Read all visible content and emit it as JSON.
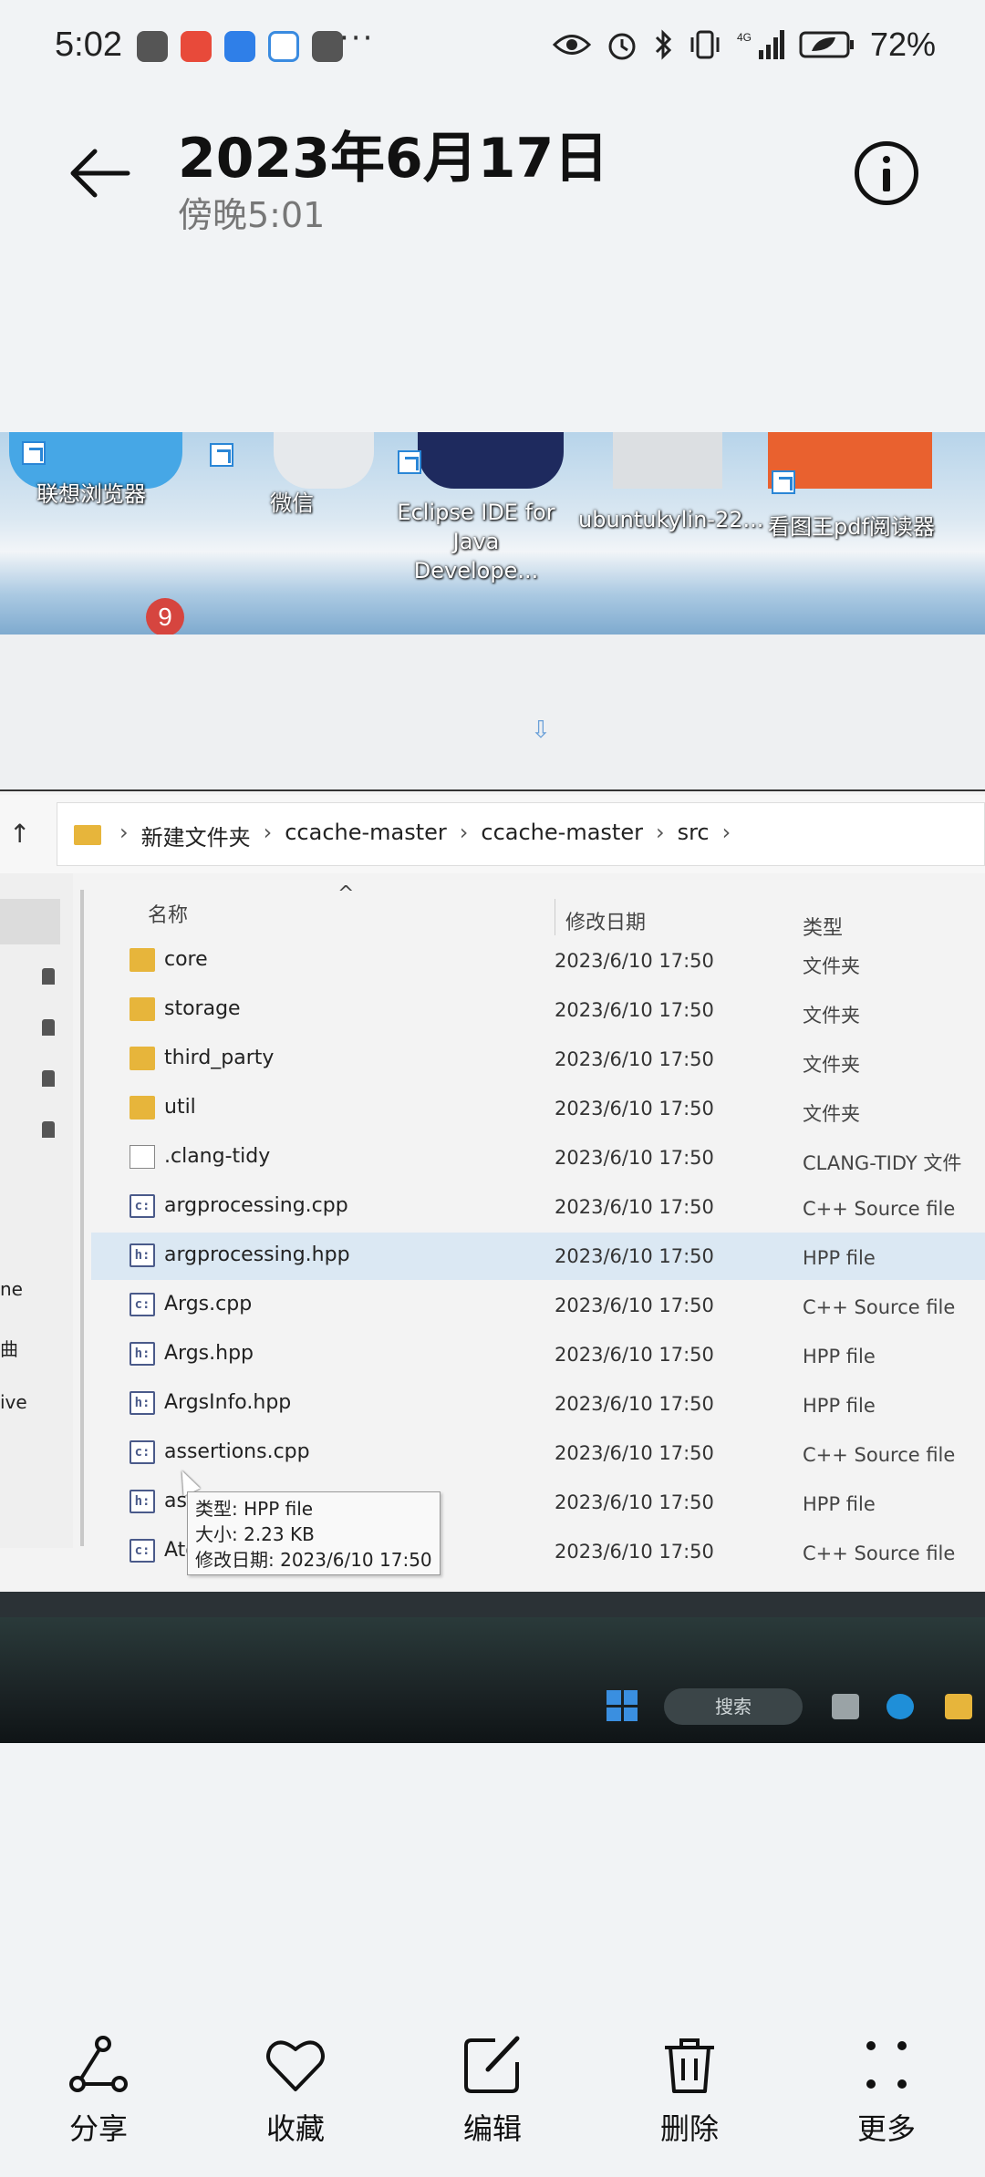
{
  "status_bar": {
    "time": "5:02",
    "dots": "···",
    "battery": "72%",
    "network_label": "4G"
  },
  "header": {
    "title": "2023年6月17日",
    "subtitle": "傍晚5:01"
  },
  "desktop": {
    "icons": [
      {
        "label": "联想浏览器"
      },
      {
        "label": "微信"
      },
      {
        "label": "Eclipse IDE for Java Develope..."
      },
      {
        "label": "ubuntukylin-22..."
      },
      {
        "label": "看图王pdf阅读器"
      }
    ],
    "badge": "9"
  },
  "explorer": {
    "breadcrumbs": [
      "新建文件夹",
      "ccache-master",
      "ccache-master",
      "src"
    ],
    "columns": {
      "name": "名称",
      "date": "修改日期",
      "type": "类型"
    },
    "rows": [
      {
        "name": "core",
        "date": "2023/6/10 17:50",
        "type": "文件夹",
        "kind": "folder"
      },
      {
        "name": "storage",
        "date": "2023/6/10 17:50",
        "type": "文件夹",
        "kind": "folder"
      },
      {
        "name": "third_party",
        "date": "2023/6/10 17:50",
        "type": "文件夹",
        "kind": "folder"
      },
      {
        "name": "util",
        "date": "2023/6/10 17:50",
        "type": "文件夹",
        "kind": "folder"
      },
      {
        "name": ".clang-tidy",
        "date": "2023/6/10 17:50",
        "type": "CLANG-TIDY 文件",
        "kind": "file"
      },
      {
        "name": "argprocessing.cpp",
        "date": "2023/6/10 17:50",
        "type": "C++ Source file",
        "kind": "cpp"
      },
      {
        "name": "argprocessing.hpp",
        "date": "2023/6/10 17:50",
        "type": "HPP file",
        "kind": "hpp"
      },
      {
        "name": "Args.cpp",
        "date": "2023/6/10 17:50",
        "type": "C++ Source file",
        "kind": "cpp"
      },
      {
        "name": "Args.hpp",
        "date": "2023/6/10 17:50",
        "type": "HPP file",
        "kind": "hpp"
      },
      {
        "name": "ArgsInfo.hpp",
        "date": "2023/6/10 17:50",
        "type": "HPP file",
        "kind": "hpp"
      },
      {
        "name": "assertions.cpp",
        "date": "2023/6/10 17:50",
        "type": "C++ Source file",
        "kind": "cpp"
      },
      {
        "name": "assertions.hpp",
        "date": "2023/6/10 17:50",
        "type": "HPP file",
        "kind": "hpp"
      },
      {
        "name": "AtomicFile.cpp",
        "date": "2023/6/10 17:50",
        "type": "C++ Source file",
        "kind": "cpp"
      }
    ],
    "tooltip": {
      "type_line": "类型: HPP file",
      "size_line": "大小: 2.23 KB",
      "date_line": "修改日期: 2023/6/10 17:50"
    },
    "nav_labels": [
      "ne",
      "曲",
      "ive"
    ]
  },
  "taskbar": {
    "search_label": "搜索"
  },
  "bottom_bar": {
    "share": "分享",
    "favorite": "收藏",
    "edit": "编辑",
    "delete": "删除",
    "more": "更多"
  },
  "colors": {
    "background": "#f1f3f5",
    "folder": "#e7b53b",
    "hover_row": "#dbe8f3",
    "badge": "#d6453f"
  }
}
